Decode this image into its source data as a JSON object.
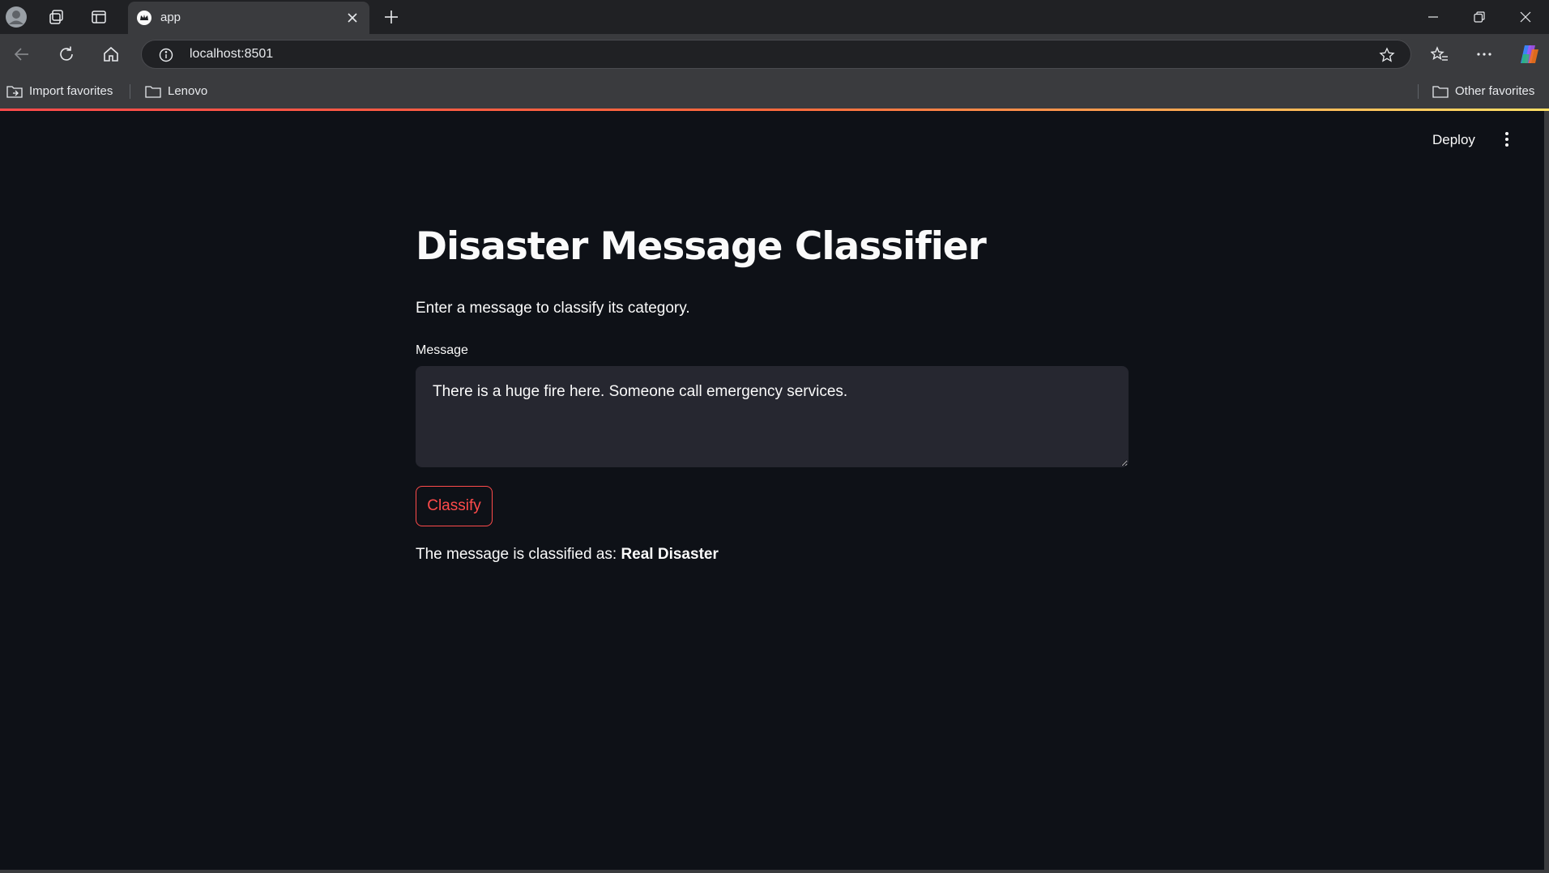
{
  "browser": {
    "tab_title": "app",
    "address": "localhost:8501",
    "favorites": [
      {
        "label": "Import favorites"
      },
      {
        "label": "Lenovo"
      }
    ],
    "other_favorites": "Other favorites"
  },
  "app": {
    "deploy_label": "Deploy",
    "title": "Disaster Message Classifier",
    "subtitle": "Enter a message to classify its category.",
    "message_label": "Message",
    "message_value": "There is a huge fire here. Someone call emergency services.",
    "classify_label": "Classify",
    "result_prefix": "The message is classified as: ",
    "result_value": "Real Disaster"
  },
  "colors": {
    "background": "#0e1117",
    "accent": "#ff4b4b",
    "input_bg": "#262730",
    "text": "#fafafa"
  },
  "icons": [
    "profile-icon",
    "workspaces-icon",
    "tab-actions-icon",
    "streamlit-crown-icon",
    "close-tab-icon",
    "new-tab-icon",
    "minimize-icon",
    "restore-icon",
    "close-window-icon",
    "back-icon",
    "refresh-icon",
    "home-icon",
    "site-info-icon",
    "favorite-star-icon",
    "favorites-icon",
    "more-icon",
    "copilot-icon",
    "import-icon",
    "folder-icon",
    "kebab-menu-icon"
  ]
}
